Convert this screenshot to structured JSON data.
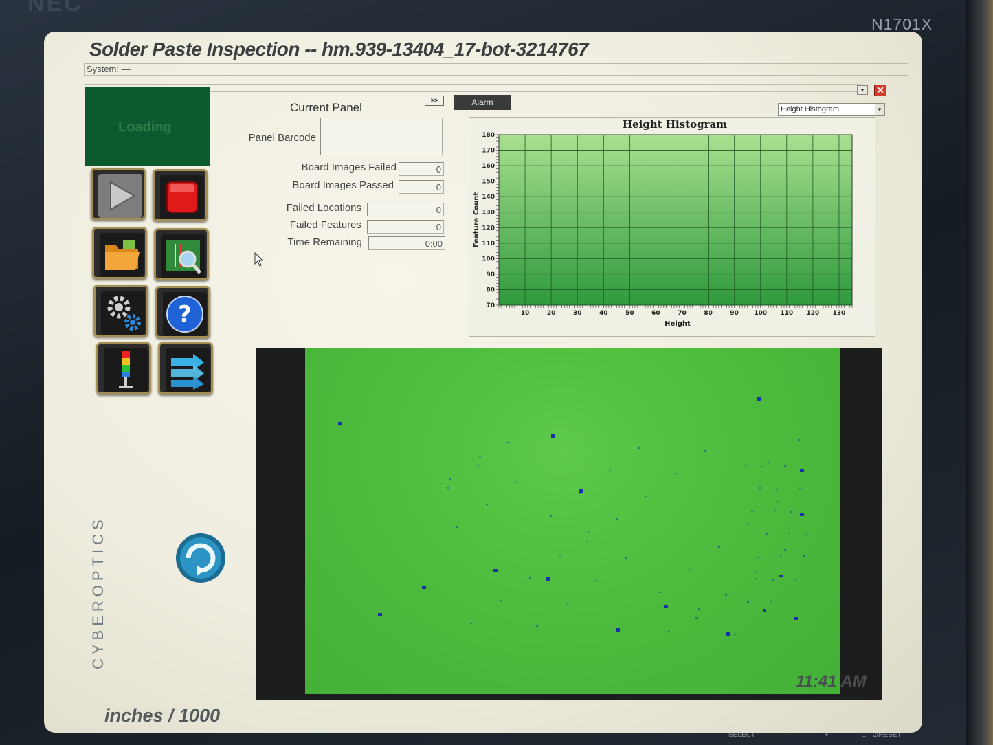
{
  "monitor": {
    "brand": "NEC",
    "model": "N1701X",
    "buttons": [
      "SELECT",
      "-",
      "+",
      "1—2/RESET"
    ]
  },
  "app": {
    "title": "Solder Paste Inspection -- hm.939-13404_17-bot-3214767",
    "system_line": "System: —",
    "window_controls": {
      "minimize": "▾",
      "close": "✕"
    }
  },
  "status": {
    "text": "Loading"
  },
  "toolbar": {
    "buttons": [
      {
        "icon": "play-icon"
      },
      {
        "icon": "stop-icon"
      },
      {
        "icon": "folder-icon"
      },
      {
        "icon": "board-inspect-icon"
      },
      {
        "icon": "settings-gears-icon"
      },
      {
        "icon": "help-icon"
      },
      {
        "icon": "stack-light-icon"
      },
      {
        "icon": "transfer-arrows-icon"
      }
    ]
  },
  "current_panel": {
    "title": "Current Panel",
    "expand_button": ">>",
    "barcode_label": "Panel Barcode",
    "barcode_value": "",
    "stats": [
      {
        "label": "Board Images Failed",
        "value": "0"
      },
      {
        "label": "Board Images Passed",
        "value": "0"
      },
      {
        "label": "Failed Locations",
        "value": "0"
      },
      {
        "label": "Failed Features",
        "value": "0"
      },
      {
        "label": "Time Remaining",
        "value": "0:00"
      }
    ]
  },
  "alarm_tab": "Alarm",
  "histogram_select": {
    "selected": "Height Histogram",
    "arrow": "▼"
  },
  "chart_data": {
    "type": "bar",
    "title": "Height Histogram",
    "xlabel": "Height",
    "ylabel": "Feature Count",
    "xlim": [
      0,
      135
    ],
    "ylim": [
      70,
      180
    ],
    "xticks": [
      10,
      20,
      30,
      40,
      50,
      60,
      70,
      80,
      90,
      100,
      110,
      120,
      130
    ],
    "yticks": [
      70,
      80,
      90,
      100,
      110,
      120,
      130,
      140,
      150,
      160,
      170,
      180
    ],
    "grid": true,
    "series": []
  },
  "clock": "11:41 AM",
  "units": "inches / 1000",
  "logo": "CYBEROPTICS"
}
